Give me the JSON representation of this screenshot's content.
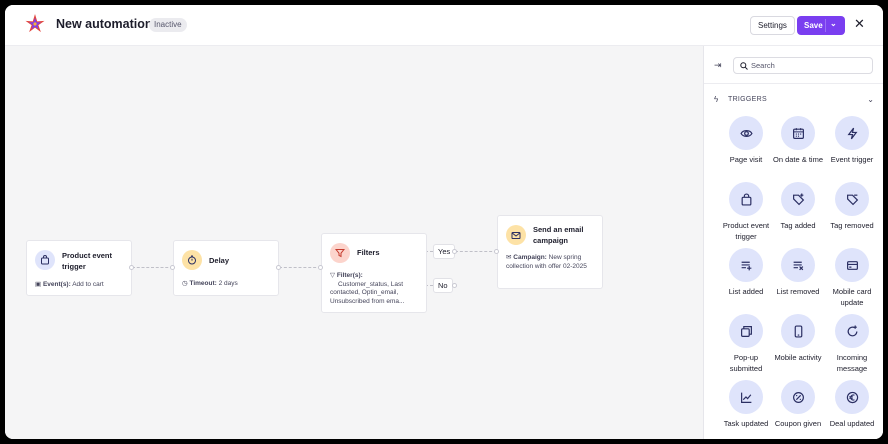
{
  "header": {
    "title": "New automation",
    "status_badge": "Inactive",
    "settings_label": "Settings",
    "save_label": "Save",
    "close_icon": "close-icon",
    "accent_color": "#7a3ef0"
  },
  "flow": {
    "nodes": [
      {
        "title": "Product event trigger",
        "meta_label": "Event(s):",
        "meta_value": "Add to cart",
        "icon": "shopping-bag-icon",
        "icon_bg": "#dfe4fb"
      },
      {
        "title": "Delay",
        "meta_label": "Timeout:",
        "meta_value": "2 days",
        "icon": "timer-icon",
        "icon_bg": "#fde2a6"
      },
      {
        "title": "Filters",
        "meta_label": "Filter(s):",
        "meta_value": "Customer_status, Last contacted, Optin_email, Unsubscribed from ema...",
        "icon": "filter-icon",
        "icon_bg": "#fcd4cc"
      },
      {
        "title": "Send an email campaign",
        "meta_label": "Campaign:",
        "meta_value": "New spring collection with offer 02-2025",
        "icon": "email-send-icon",
        "icon_bg": "#fde2a6"
      }
    ],
    "yes_label": "Yes",
    "no_label": "No"
  },
  "panel": {
    "search_placeholder": "Search",
    "section_title": "TRIGGERS",
    "triggers": [
      {
        "label": "Page visit",
        "icon": "eye-icon"
      },
      {
        "label": "On date & time",
        "icon": "calendar-icon"
      },
      {
        "label": "Event trigger",
        "icon": "lightning-icon"
      },
      {
        "label": "Product event trigger",
        "icon": "shopping-bag-icon"
      },
      {
        "label": "Tag added",
        "icon": "tag-plus-icon"
      },
      {
        "label": "Tag removed",
        "icon": "tag-minus-icon"
      },
      {
        "label": "List added",
        "icon": "list-add-icon"
      },
      {
        "label": "List removed",
        "icon": "list-remove-icon"
      },
      {
        "label": "Mobile card update",
        "icon": "card-icon"
      },
      {
        "label": "Pop-up submitted",
        "icon": "popup-icon"
      },
      {
        "label": "Mobile activity",
        "icon": "mobile-icon"
      },
      {
        "label": "Incoming message",
        "icon": "message-icon"
      },
      {
        "label": "Task updated",
        "icon": "chart-line-icon"
      },
      {
        "label": "Coupon given",
        "icon": "coupon-icon"
      },
      {
        "label": "Deal updated",
        "icon": "euro-icon"
      }
    ]
  }
}
